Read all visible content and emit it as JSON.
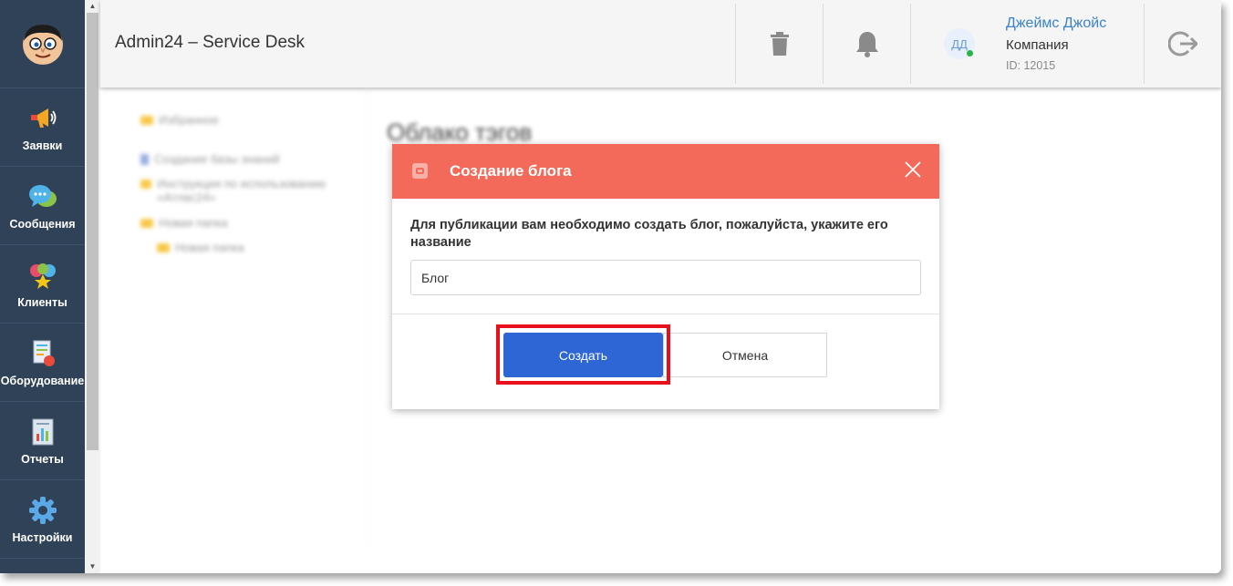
{
  "header": {
    "title": "Admin24 – Service Desk",
    "user": {
      "initials": "ДД",
      "name": "Джеймс Джойс",
      "company": "Компания",
      "id": "ID: 12015"
    }
  },
  "sidebar": {
    "items": [
      {
        "label": "Заявки",
        "icon": "megaphone-icon"
      },
      {
        "label": "Сообщения",
        "icon": "chat-bubbles-icon"
      },
      {
        "label": "Клиенты",
        "icon": "clients-hearts-icon"
      },
      {
        "label": "Оборудование",
        "icon": "equipment-list-icon"
      },
      {
        "label": "Отчеты",
        "icon": "report-chart-icon"
      },
      {
        "label": "Настройки",
        "icon": "gear-icon"
      }
    ]
  },
  "background": {
    "tree": [
      "Избранное",
      "Создание базы знаний",
      "Инструкция по использованию «Атлас24»",
      "Новая папка",
      "Новая папка"
    ],
    "section_title": "Облако тэгов"
  },
  "modal": {
    "title": "Создание блога",
    "message": "Для публикации вам необходимо создать блог, пожалуйста, укажите его название",
    "input_value": "Блог",
    "create_label": "Создать",
    "cancel_label": "Отмена"
  },
  "colors": {
    "sidebar_bg": "#2f4257",
    "modal_header": "#f36a5a",
    "primary_button": "#2e66d6",
    "highlight": "#e8101b",
    "link": "#3b82c9"
  }
}
